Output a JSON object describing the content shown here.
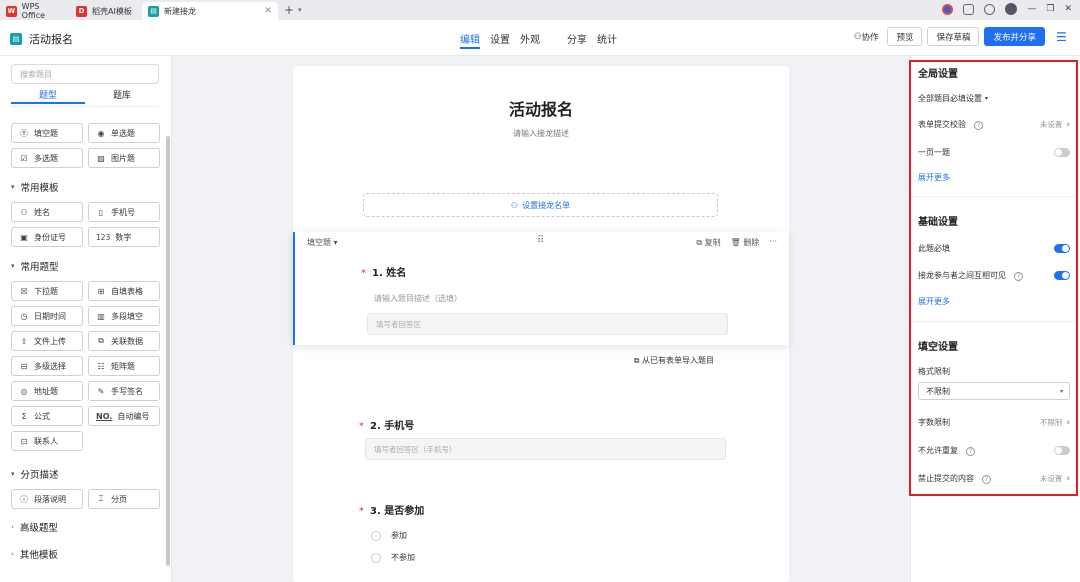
{
  "tabs": [
    {
      "label": "WPS Office",
      "icon": "wps-logo-icon",
      "color": "#e5322d"
    },
    {
      "label": "稻壳AI模板",
      "icon": "docer-logo-icon",
      "color": "#e5322d"
    },
    {
      "label": "新建接龙",
      "icon": "form-logo-icon",
      "color": "#17a1a1"
    }
  ],
  "header": {
    "app_title": "活动报名",
    "nav": [
      "编辑",
      "设置",
      "外观",
      "分享",
      "统计"
    ],
    "active_nav": "编辑",
    "collab": "协作",
    "preview": "预览",
    "save_draft": "保存草稿",
    "publish": "发布并分享"
  },
  "sidebar": {
    "search_placeholder": "搜索题目",
    "tabs": [
      "题型",
      "题库"
    ],
    "basic": [
      {
        "label": "填空题",
        "icon": "text-field-icon"
      },
      {
        "label": "单选题",
        "icon": "radio-icon"
      },
      {
        "label": "多选题",
        "icon": "checkbox-icon"
      },
      {
        "label": "图片题",
        "icon": "image-icon"
      }
    ],
    "sections": [
      {
        "title": "常用模板",
        "expanded": true,
        "items": [
          {
            "label": "姓名",
            "icon": "person-icon"
          },
          {
            "label": "手机号",
            "icon": "phone-icon"
          },
          {
            "label": "身份证号",
            "icon": "id-card-icon"
          },
          {
            "label": "数字",
            "icon": "number-icon"
          }
        ]
      },
      {
        "title": "常用题型",
        "expanded": true,
        "items": [
          {
            "label": "下拉题",
            "icon": "dropdown-icon"
          },
          {
            "label": "自填表格",
            "icon": "table-icon"
          },
          {
            "label": "日期时间",
            "icon": "clock-icon"
          },
          {
            "label": "多段填空",
            "icon": "multi-blank-icon"
          },
          {
            "label": "文件上传",
            "icon": "upload-icon"
          },
          {
            "label": "关联数据",
            "icon": "link-data-icon"
          },
          {
            "label": "多级选择",
            "icon": "cascade-icon"
          },
          {
            "label": "矩阵题",
            "icon": "matrix-icon"
          },
          {
            "label": "地址题",
            "icon": "location-icon"
          },
          {
            "label": "手写签名",
            "icon": "signature-icon"
          },
          {
            "label": "公式",
            "icon": "sigma-icon"
          },
          {
            "label": "自动编号",
            "icon": "auto-number-icon"
          },
          {
            "label": "联系人",
            "icon": "contact-icon"
          }
        ]
      },
      {
        "title": "分页描述",
        "expanded": true,
        "items": [
          {
            "label": "段落说明",
            "icon": "info-icon"
          },
          {
            "label": "分页",
            "icon": "page-break-icon"
          }
        ]
      },
      {
        "title": "高级题型",
        "expanded": false,
        "items": []
      },
      {
        "title": "其他模板",
        "expanded": false,
        "items": []
      }
    ]
  },
  "form": {
    "title": "活动报名",
    "description": "请输入接龙描述",
    "roster_button": "设置接龙名单",
    "active_question": {
      "type": "填空题",
      "copy": "复制",
      "delete": "删除",
      "more": "···",
      "title": "1. 姓名",
      "desc_placeholder": "请输入题目描述（选填）",
      "answer_placeholder": "填写者回答区"
    },
    "import_link": "从已有表单导入题目",
    "q2": {
      "title": "2. 手机号",
      "answer_placeholder": "填写者回答区（手机号）"
    },
    "q3": {
      "title": "3. 是否参加",
      "options": [
        "参加",
        "不参加"
      ]
    }
  },
  "panel": {
    "global": {
      "title": "全局设置",
      "all_required": "全部题目必填设置",
      "submit_check": "表单提交校验",
      "submit_check_value": "未设置",
      "one_per_page": "一页一题",
      "one_per_page_on": false,
      "more": "展开更多"
    },
    "basic": {
      "title": "基础设置",
      "required": "此题必填",
      "required_on": true,
      "visible": "接龙参与者之间互相可见",
      "visible_on": true,
      "more": "展开更多"
    },
    "fill": {
      "title": "填空设置",
      "format_limit": "格式限制",
      "format_value": "不限制",
      "char_limit": "字数限制",
      "char_limit_value": "不限制",
      "no_duplicate": "不允许重复",
      "no_duplicate_on": false,
      "forbid": "禁止提交的内容",
      "forbid_value": "未设置"
    }
  },
  "colors": {
    "accent": "#1f6ff2",
    "highlight_box": "#e02020"
  }
}
